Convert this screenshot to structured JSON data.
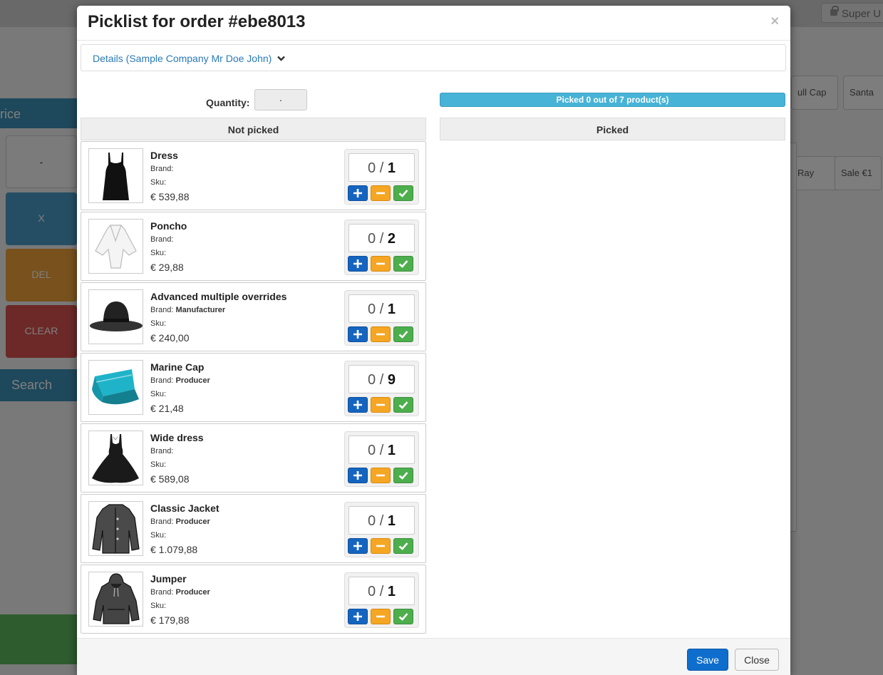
{
  "background": {
    "user_label": "Super U",
    "left_title": "rice",
    "keys": [
      "-",
      "X",
      "DEL",
      "CLEAR"
    ],
    "search_label": "Search",
    "tiles": [
      "ull Cap",
      "Santa",
      "Ray",
      "Sale €1"
    ]
  },
  "modal": {
    "title": "Picklist for order #ebe8013",
    "close_symbol": "×",
    "details_label": "Details (Sample Company Mr Doe John)",
    "quantity_label": "Quantity:",
    "quantity_value": "·",
    "progress": {
      "text": "Picked 0 out of 7 product(s)",
      "picked": 0,
      "total": 7
    },
    "not_picked_header": "Not picked",
    "picked_header": "Picked",
    "items": [
      {
        "name": "Dress",
        "brand_label": "Brand:",
        "brand": "",
        "sku_label": "Sku:",
        "price": "€ 539,88",
        "picked": "0",
        "sep": "/",
        "required": "1",
        "image": "dress-icon"
      },
      {
        "name": "Poncho",
        "brand_label": "Brand:",
        "brand": "",
        "sku_label": "Sku:",
        "price": "€ 29,88",
        "picked": "0",
        "sep": "/",
        "required": "2",
        "image": "poncho-icon"
      },
      {
        "name": "Advanced multiple overrides",
        "brand_label": "Brand:",
        "brand": "Manufacturer",
        "sku_label": "Sku:",
        "price": "€ 240,00",
        "picked": "0",
        "sep": "/",
        "required": "1",
        "image": "bowler-hat-icon"
      },
      {
        "name": "Marine Cap",
        "brand_label": "Brand:",
        "brand": "Producer",
        "sku_label": "Sku:",
        "price": "€ 21,48",
        "picked": "0",
        "sep": "/",
        "required": "9",
        "image": "cap-icon"
      },
      {
        "name": "Wide dress",
        "brand_label": "Brand:",
        "brand": "",
        "sku_label": "Sku:",
        "price": "€ 589,08",
        "picked": "0",
        "sep": "/",
        "required": "1",
        "image": "wide-dress-icon"
      },
      {
        "name": "Classic Jacket",
        "brand_label": "Brand:",
        "brand": "Producer",
        "sku_label": "Sku:",
        "price": "€ 1.079,88",
        "picked": "0",
        "sep": "/",
        "required": "1",
        "image": "jacket-icon"
      },
      {
        "name": "Jumper",
        "brand_label": "Brand:",
        "brand": "Producer",
        "sku_label": "Sku:",
        "price": "€ 179,88",
        "picked": "0",
        "sep": "/",
        "required": "1",
        "image": "hoodie-icon"
      }
    ],
    "save_label": "Save",
    "close_label": "Close"
  },
  "colors": {
    "primary": "#0f6ecd",
    "info": "#47b3d6",
    "warning": "#f5a623",
    "success": "#4cae4c",
    "plus": "#1565c0"
  }
}
